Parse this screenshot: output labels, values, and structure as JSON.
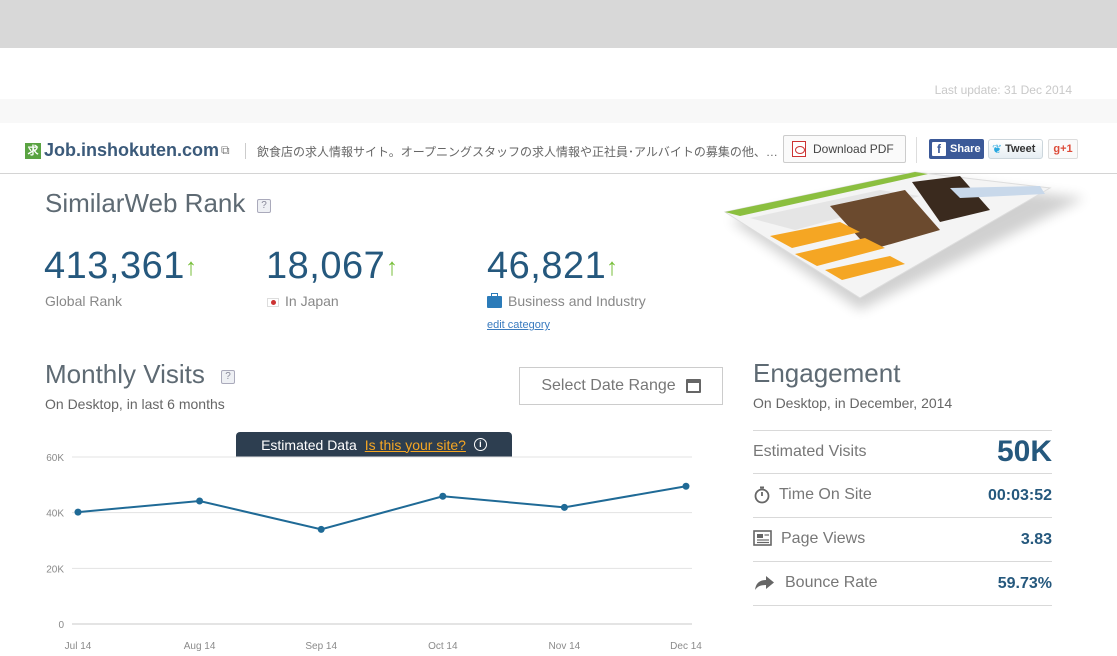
{
  "header": {
    "last_update": "Last update: 31 Dec 2014"
  },
  "site": {
    "favicon_glyph": "求",
    "name": "Job.inshokuten.com",
    "description": "飲食店の求人情報サイト。オープニングスタッフの求人情報や正社員･アルバイトの募集の他、…",
    "download_pdf": "Download PDF",
    "share_label": "Share",
    "tweet_label": "Tweet",
    "gplus_label": "g+1"
  },
  "rank": {
    "title": "SimilarWeb Rank",
    "help": "?",
    "global": {
      "value": "413,361",
      "label": "Global Rank",
      "trend": "↑"
    },
    "country": {
      "value": "18,067",
      "label": "In Japan",
      "trend": "↑"
    },
    "category": {
      "value": "46,821",
      "label": "Business and Industry",
      "trend": "↑"
    },
    "edit_category": "edit category"
  },
  "visits": {
    "title": "Monthly Visits",
    "help": "?",
    "subtitle": "On Desktop, in last 6 months",
    "date_range": "Select Date Range",
    "estimated_data": "Estimated Data",
    "is_this_your_site": "Is this your site?",
    "info": "i"
  },
  "chart_data": {
    "type": "line",
    "categories": [
      "Jul 14",
      "Aug 14",
      "Sep 14",
      "Oct 14",
      "Nov 14",
      "Dec 14"
    ],
    "values": [
      40200,
      44200,
      34000,
      45900,
      41900,
      49500
    ],
    "y_ticks": [
      "0",
      "20K",
      "40K",
      "60K"
    ],
    "ylim": [
      0,
      60000
    ],
    "grid": true,
    "line_color": "#1f6a96"
  },
  "engagement": {
    "title": "Engagement",
    "subtitle": "On Desktop, in December, 2014",
    "rows": [
      {
        "label": "Estimated Visits",
        "value": "50K"
      },
      {
        "label": "Time On Site",
        "value": "00:03:52",
        "icon": "stopwatch-icon"
      },
      {
        "label": "Page Views",
        "value": "3.83",
        "icon": "page-views-icon"
      },
      {
        "label": "Bounce Rate",
        "value": "59.73%",
        "icon": "bounce-arrow-icon"
      }
    ]
  }
}
